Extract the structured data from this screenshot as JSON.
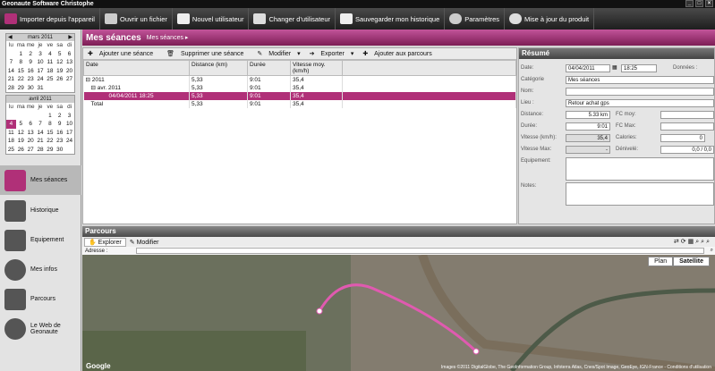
{
  "window": {
    "title": "Geonaute Software    Christophe"
  },
  "toolbar": {
    "import": "Importer depuis l'appareil",
    "open": "Ouvrir un fichier",
    "new_user": "Nouvel utilisateur",
    "change_user": "Changer d'utilisateur",
    "save_history": "Sauvegarder mon historique",
    "settings": "Paramètres",
    "update": "Mise à jour du produit"
  },
  "calendar": {
    "month1": "mars 2011",
    "month2": "avril 2011",
    "days": [
      "lu",
      "ma",
      "me",
      "je",
      "ve",
      "sa",
      "di"
    ],
    "mars": [
      "",
      "1",
      "2",
      "3",
      "4",
      "5",
      "6",
      "7",
      "8",
      "9",
      "10",
      "11",
      "12",
      "13",
      "14",
      "15",
      "16",
      "17",
      "18",
      "19",
      "20",
      "21",
      "22",
      "23",
      "24",
      "25",
      "26",
      "27",
      "28",
      "29",
      "30",
      "31",
      "",
      "",
      ""
    ],
    "avril": [
      "",
      "",
      "",
      "",
      "1",
      "2",
      "3",
      "4",
      "5",
      "6",
      "7",
      "8",
      "9",
      "10",
      "11",
      "12",
      "13",
      "14",
      "15",
      "16",
      "17",
      "18",
      "19",
      "20",
      "21",
      "22",
      "23",
      "24",
      "25",
      "26",
      "27",
      "28",
      "29",
      "30",
      ""
    ],
    "selected": "4"
  },
  "nav": {
    "seances": "Mes séances",
    "historique": "Historique",
    "equipement": "Equipement",
    "infos": "Mes infos",
    "parcours": "Parcours",
    "web": "Le Web de Geonaute"
  },
  "seances": {
    "title": "Mes séances",
    "breadcrumb": "Mes séances",
    "add": "Ajouter une séance",
    "delete": "Supprimer une séance",
    "modify": "Modifier",
    "export": "Exporter",
    "add_route": "Ajouter aux parcours",
    "cols": [
      "Date",
      "Distance (km)",
      "Durée",
      "Vitesse moy. (km/h)"
    ],
    "rows": [
      {
        "d": "2011",
        "dist": "5,33",
        "dur": "9:01",
        "v": "35,4"
      },
      {
        "d": "avr. 2011",
        "dist": "5,33",
        "dur": "9:01",
        "v": "35,4"
      },
      {
        "d": "04/04/2011 18:25",
        "dist": "5,33",
        "dur": "9:01",
        "v": "35,4"
      },
      {
        "d": "Total",
        "dist": "5,33",
        "dur": "9:01",
        "v": "35,4"
      }
    ]
  },
  "resume": {
    "title": "Résumé",
    "date_l": "Date:",
    "date": "04/04/2011",
    "time": "18:25",
    "donnees": "Données :",
    "cat_l": "Catégorie",
    "cat": "Mes séances",
    "nom_l": "Nom:",
    "lieu_l": "Lieu :",
    "lieu": "Retour achat gps",
    "dist_l": "Distance:",
    "dist": "5.33 km",
    "duree_l": "Durée:",
    "duree": "9:01",
    "vit_l": "Vitesse (km/h):",
    "vit": "35,4",
    "vmax_l": "Vitesse Max:",
    "vmax": "-",
    "fcmoy_l": "FC moy:",
    "fcmax_l": "FC Max:",
    "cal_l": "Calories:",
    "cal": "0",
    "den_l": "Dénivelé:",
    "den": "0,0 / 0,0",
    "equip_l": "Equipement:",
    "notes_l": "Notes:"
  },
  "parcours": {
    "title": "Parcours",
    "explore": "Explorer",
    "modify": "Modifier",
    "address_l": "Adresse :",
    "plan": "Plan",
    "satellite": "Satellite",
    "copyright": "Images ©2011 DigitalGlobe, The GeoInformation Group, Infoterra Atlas, Cnes/Spot Image, GeoEye, IGN-France - Conditions d'utilisation",
    "google": "Google"
  }
}
